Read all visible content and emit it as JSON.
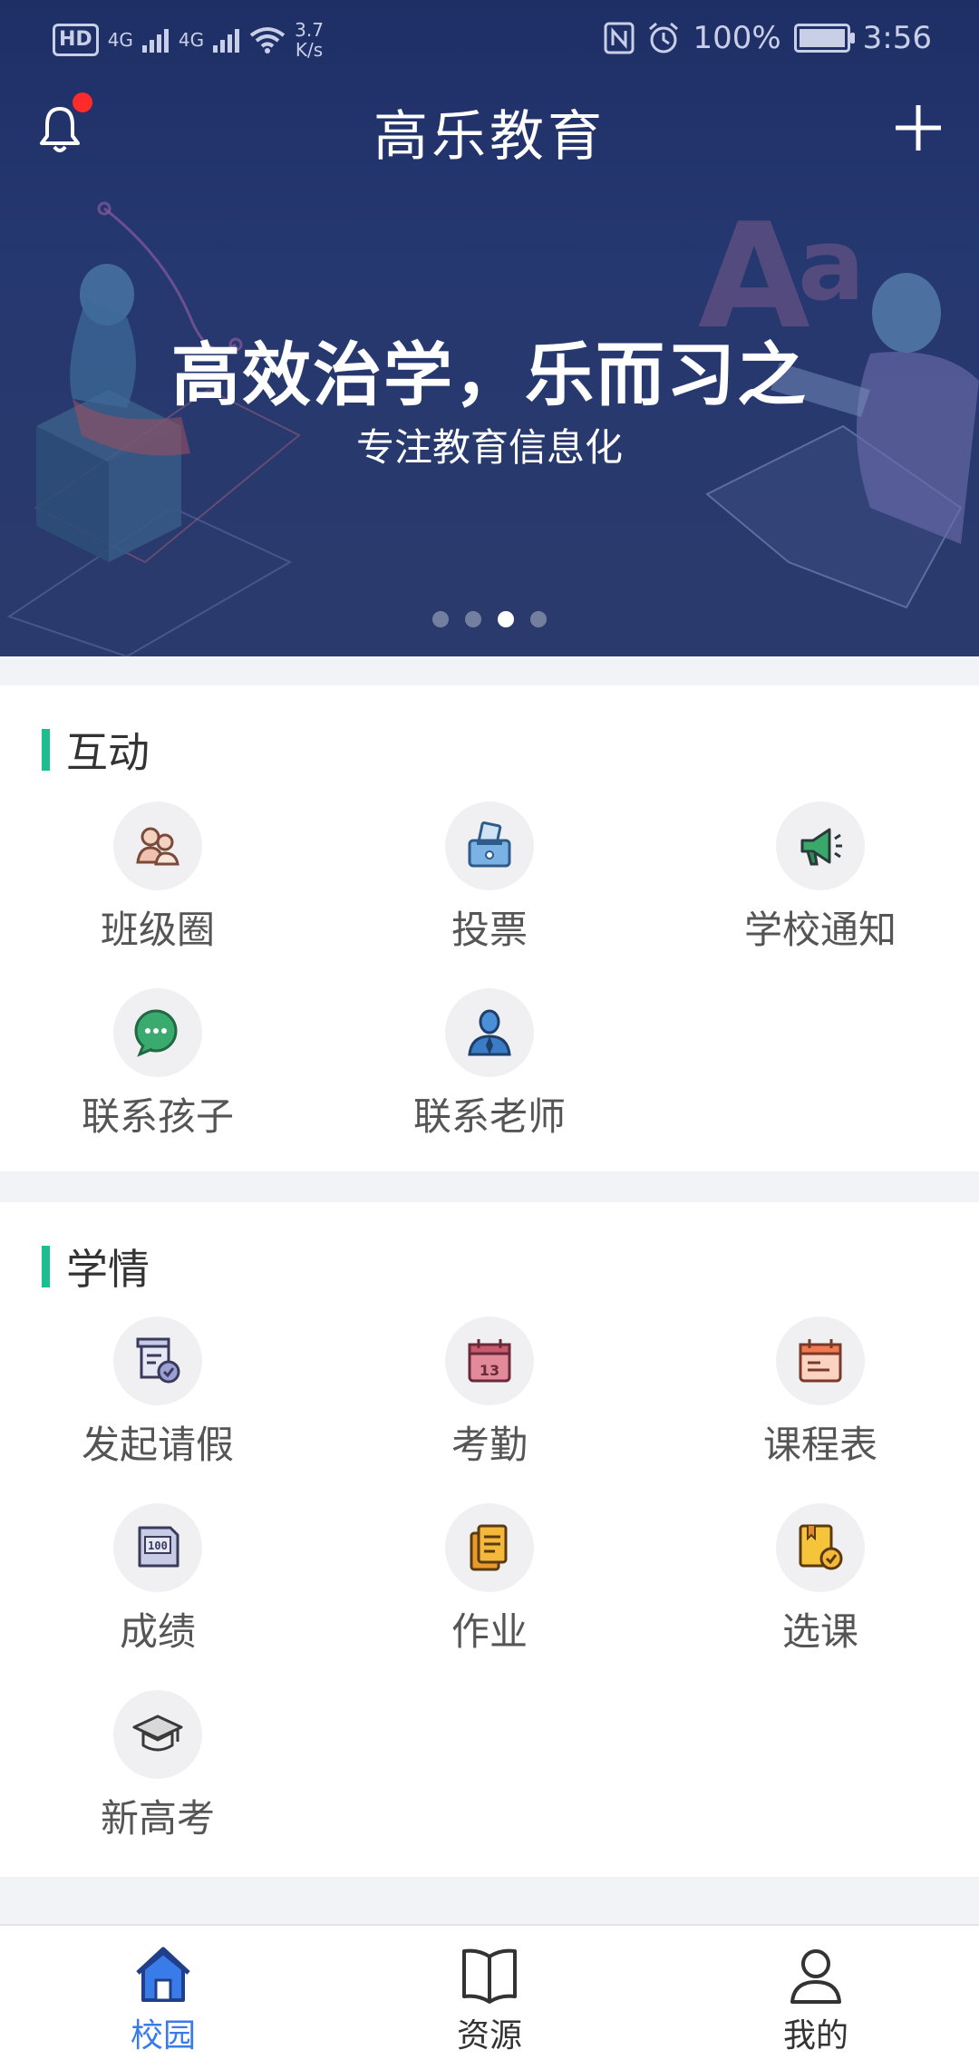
{
  "status_bar": {
    "left_badge": "HD",
    "network_speed": "3.7\nK/s",
    "network_speed_top": "3.7",
    "network_speed_bottom": "K/s",
    "signal_label_1": "4G",
    "signal_label_2": "4G",
    "battery_percent": "100%",
    "time": "3:56"
  },
  "header": {
    "title": "高乐教育",
    "notification_dot_color": "#ff2a2a"
  },
  "banner": {
    "title": "高效治学，乐而习之",
    "subtitle": "专注教育信息化",
    "page_count": 4,
    "active_index": 2
  },
  "sections": [
    {
      "title": "互动",
      "items": [
        {
          "label": "班级圈",
          "icon": "class-circle-icon"
        },
        {
          "label": "投票",
          "icon": "vote-icon"
        },
        {
          "label": "学校通知",
          "icon": "megaphone-icon"
        },
        {
          "label": "联系孩子",
          "icon": "chat-bubble-icon"
        },
        {
          "label": "联系老师",
          "icon": "teacher-icon"
        }
      ]
    },
    {
      "title": "学情",
      "items": [
        {
          "label": "发起请假",
          "icon": "leave-request-icon"
        },
        {
          "label": "考勤",
          "icon": "calendar-icon"
        },
        {
          "label": "课程表",
          "icon": "schedule-icon"
        },
        {
          "label": "成绩",
          "icon": "score-icon"
        },
        {
          "label": "作业",
          "icon": "homework-icon"
        },
        {
          "label": "选课",
          "icon": "course-select-icon"
        },
        {
          "label": "新高考",
          "icon": "graduation-cap-icon"
        }
      ]
    }
  ],
  "tabbar": {
    "tabs": [
      {
        "label": "校园",
        "icon": "home-icon",
        "active": true
      },
      {
        "label": "资源",
        "icon": "book-icon",
        "active": false
      },
      {
        "label": "我的",
        "icon": "user-icon",
        "active": false
      }
    ],
    "active_color": "#3a7bea"
  },
  "colors": {
    "accent_green": "#1bbf8f",
    "header_bg": "#1e2f66"
  }
}
